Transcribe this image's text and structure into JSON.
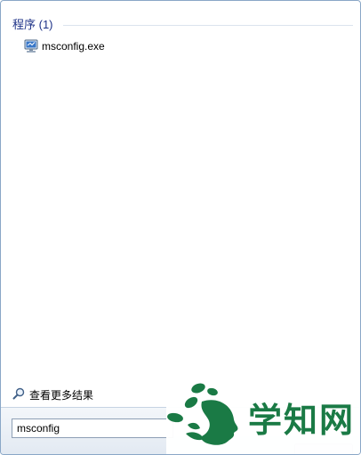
{
  "results": {
    "group_title": "程序 (1)",
    "items": [
      {
        "label": "msconfig.exe",
        "icon": "monitor-icon"
      }
    ]
  },
  "more_results": {
    "label": "查看更多结果",
    "icon": "magnifier-icon"
  },
  "search": {
    "value": "msconfig"
  },
  "watermark": {
    "text": "学知网",
    "color": "#1a7a45"
  },
  "colors": {
    "group_title": "#1e3287",
    "accent": "#1a7a45"
  }
}
